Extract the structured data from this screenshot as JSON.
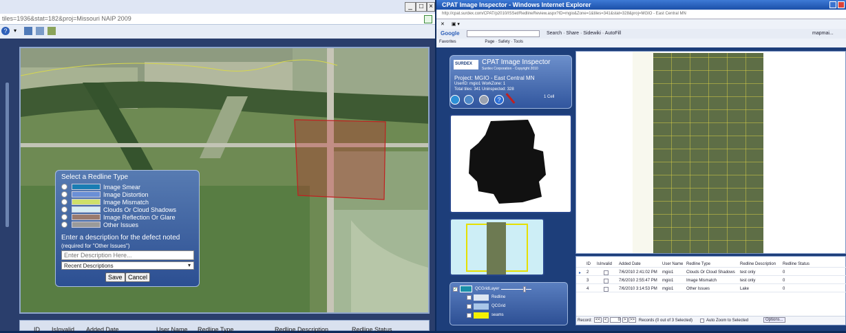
{
  "left_window": {
    "address": "tiles=1936&stat=182&proj=Missouri NAIP 2009",
    "redline_panel": {
      "title": "Select a Redline Type",
      "options": [
        {
          "label": "Image Smear",
          "color": "#1a7db3"
        },
        {
          "label": "Image Distortion",
          "color": "#6a8fd6"
        },
        {
          "label": "Image Mismatch",
          "color": "#cfe06a"
        },
        {
          "label": "Clouds Or Cloud Shadows",
          "color": "#d6ecf5"
        },
        {
          "label": "Image Reflection Or Glare",
          "color": "#9a7a6e"
        },
        {
          "label": "Other Issues",
          "color": "#9a9a9a"
        }
      ],
      "desc_heading": "Enter a description for the defect noted",
      "desc_note": "(required for \"Other Issues\")",
      "desc_placeholder": "Enter Description Here...",
      "recent_label": "Recent Descriptions",
      "save_label": "Save",
      "cancel_label": "Cancel"
    },
    "grid_headers": [
      "ID",
      "IsInvalid",
      "Added Date",
      "User Name",
      "Redline Type",
      "Redline Description",
      "Redline Status"
    ]
  },
  "right_window": {
    "title": "CPAT Image Inspector - Windows Internet Explorer",
    "address": "http://cpat.surdex.com/CPAT/p2010/ISSet/RedlineReview.aspx?ID=mgio&Zone=1&tiles=341&stat=328&proj=MGIO - East Central MN",
    "google_label": "Google",
    "google_tools": "Search · Share · Sidewiki · AutoFill",
    "user_label": "mapmai...",
    "favorites_label": "Favorites",
    "fav_tools": "Page · Safety · Tools",
    "cpat": {
      "logo": "SURDEX",
      "title": "CPAT Image Inspector",
      "subtitle": "Surdex Corporation - Copyright 2010",
      "project": "Project: MGIO - East Central MN",
      "user": "UserID: mgio1   WorkZone: 1",
      "tiles": "Total tiles: 341   Uninspected: 328",
      "cell": "1 Cell"
    },
    "grid": {
      "headers": [
        "ID",
        "IsInvalid",
        "Added Date",
        "User Name",
        "Redline Type",
        "Redline Description",
        "Redline Status"
      ],
      "rows": [
        {
          "id": "2",
          "date": "7/6/2010 2:41:02 PM",
          "user": "mgio1",
          "type": "Clouds Or Cloud Shadows",
          "desc": "test only",
          "status": "0"
        },
        {
          "id": "3",
          "date": "7/6/2010 2:55:47 PM",
          "user": "mgio1",
          "type": "Image Mismatch",
          "desc": "test only",
          "status": "0"
        },
        {
          "id": "4",
          "date": "7/6/2010 3:14:53 PM",
          "user": "mgio1",
          "type": "Other Issues",
          "desc": "Lake",
          "status": "0"
        }
      ],
      "record_label": "Record:",
      "page_value": "0",
      "records_text": "Records (0 out of 3 Selected)",
      "auto_zoom": "Auto Zoom to Selected",
      "options_label": "Options..."
    },
    "layers": {
      "main": "QCGridLayer",
      "items": [
        {
          "label": "Redline",
          "color": "#dde6f2"
        },
        {
          "label": "QCGrid",
          "color": "#a9c6e8"
        },
        {
          "label": "seams",
          "color": "#f4f000"
        }
      ]
    }
  }
}
